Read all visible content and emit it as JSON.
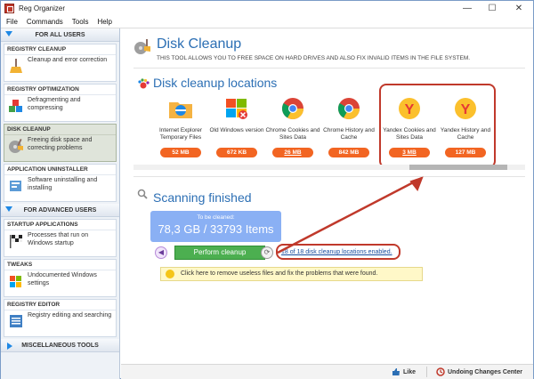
{
  "window": {
    "title": "Reg Organizer"
  },
  "menu": [
    "File",
    "Commands",
    "Tools",
    "Help"
  ],
  "sidebar": {
    "group_all": "FOR ALL USERS",
    "items_all": [
      {
        "header": "REGISTRY CLEANUP",
        "desc": "Cleanup and error correction"
      },
      {
        "header": "REGISTRY OPTIMIZATION",
        "desc": "Defragmenting and compressing"
      },
      {
        "header": "DISK CLEANUP",
        "desc": "Freeing disk space and correcting problems"
      },
      {
        "header": "APPLICATION UNINSTALLER",
        "desc": "Software uninstalling and installing"
      }
    ],
    "group_adv": "FOR ADVANCED USERS",
    "items_adv": [
      {
        "header": "STARTUP APPLICATIONS",
        "desc": "Processes that run on Windows startup"
      },
      {
        "header": "TWEAKS",
        "desc": "Undocumented Windows settings"
      },
      {
        "header": "REGISTRY EDITOR",
        "desc": "Registry editing and searching"
      }
    ],
    "group_misc": "MISCELLANEOUS TOOLS"
  },
  "main": {
    "title": "Disk Cleanup",
    "subtitle": "This tool allows you to free space on hard drives and also fix invalid items in the file system.",
    "locations_title": "Disk cleanup locations",
    "locations": [
      {
        "name": "Internet Explorer Temporary Files",
        "size": "52 MB"
      },
      {
        "name": "Old Windows version",
        "size": "672 KB"
      },
      {
        "name": "Chrome Cookies and Sites Data",
        "size": "26 MB"
      },
      {
        "name": "Chrome History and Cache",
        "size": "842 MB"
      },
      {
        "name": "Yandex Cookies and Sites Data",
        "size": "3 MB"
      },
      {
        "name": "Yandex History and Cache",
        "size": "127 MB"
      }
    ],
    "scan_title": "Scanning finished",
    "to_clean_caption": "To be cleaned:",
    "to_clean_value": "78,3 GB / 33793 Items",
    "perform_button": "Perform cleanup",
    "locations_link": "18 of 18 disk cleanup locations enabled.",
    "hint": "Click here to remove useless files and fix the problems that were found."
  },
  "status": {
    "like": "Like",
    "undo": "Undoing Changes Center"
  },
  "colors": {
    "accent": "#2c6fb4",
    "orange": "#f26522",
    "green": "#4caf50",
    "highlight": "#c0392b",
    "blue_box": "#8ab0f4"
  }
}
